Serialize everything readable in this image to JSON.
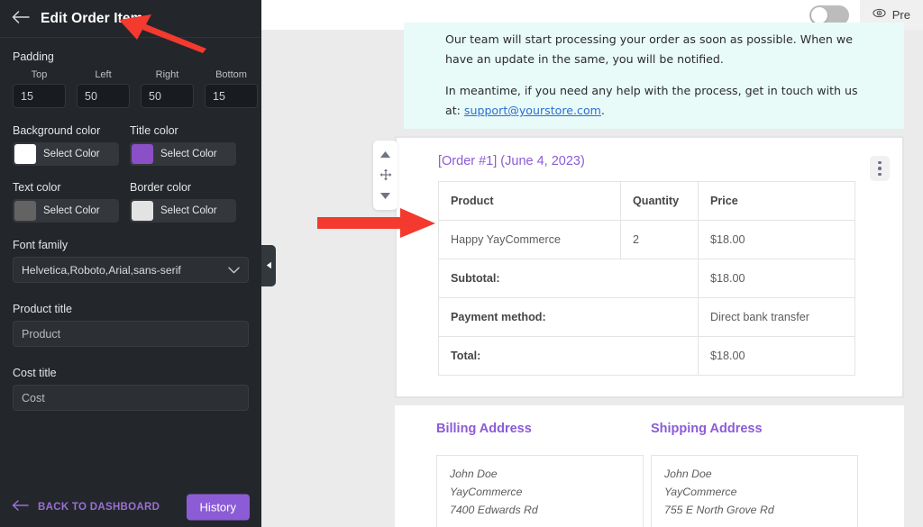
{
  "sidebar": {
    "title": "Edit Order Item",
    "back_icon": "back-arrow-icon",
    "padding": {
      "label": "Padding",
      "fields": [
        {
          "label": "Top",
          "value": "15"
        },
        {
          "label": "Left",
          "value": "50"
        },
        {
          "label": "Right",
          "value": "50"
        },
        {
          "label": "Bottom",
          "value": "15"
        }
      ]
    },
    "colors": [
      {
        "label": "Background color",
        "button": "Select Color",
        "swatch": "#ffffff"
      },
      {
        "label": "Title color",
        "button": "Select Color",
        "swatch": "#8b4fc8"
      },
      {
        "label": "Text color",
        "button": "Select Color",
        "swatch": "#636363"
      },
      {
        "label": "Border color",
        "button": "Select Color",
        "swatch": "#e3e3e3"
      }
    ],
    "font_family": {
      "label": "Font family",
      "value": "Helvetica,Roboto,Arial,sans-serif"
    },
    "product_title": {
      "label": "Product title",
      "value": "Product"
    },
    "cost_title": {
      "label": "Cost title",
      "value": "Cost"
    },
    "footer": {
      "back_to_dashboard": "BACK TO DASHBOARD",
      "history_button": "History"
    },
    "collapse_handle_icon": "chevron-left-icon"
  },
  "topbar": {
    "toggle_state": "off",
    "preview_label": "Pre",
    "preview_icon": "eye-icon"
  },
  "canvas": {
    "drag_widget": {
      "up_icon": "chevron-up-icon",
      "move_icon": "move-icon",
      "down_icon": "chevron-down-icon"
    },
    "notice": {
      "paragraph1": "Our team will start processing your order as soon as possible. When we have an update in the same, you will be notified.",
      "paragraph2_prefix": "In meantime, if you need any help with the process, get in touch with us at: ",
      "support_email": "support@yourstore.com",
      "paragraph2_suffix": ".",
      "background": "#e8fbf8"
    },
    "order": {
      "title": "[Order #1] (June 4, 2023)",
      "menu_icon": "kebab-menu-icon",
      "table": {
        "headers": [
          "Product",
          "Quantity",
          "Price"
        ],
        "rows": [
          [
            "Happy YayCommerce",
            "2",
            "$18.00"
          ]
        ],
        "summary": [
          {
            "label": "Subtotal:",
            "value": "$18.00"
          },
          {
            "label": "Payment method:",
            "value": "Direct bank transfer"
          },
          {
            "label": "Total:",
            "value": "$18.00"
          }
        ]
      }
    },
    "addresses": {
      "billing": {
        "heading": "Billing Address",
        "lines": [
          "John Doe",
          "YayCommerce",
          "7400 Edwards Rd"
        ]
      },
      "shipping": {
        "heading": "Shipping Address",
        "lines": [
          "John Doe",
          "YayCommerce",
          "755 E North Grove Rd"
        ]
      }
    }
  },
  "annotations": {
    "arrow_top_color": "#f4392f",
    "arrow_mid_color": "#f4392f"
  }
}
